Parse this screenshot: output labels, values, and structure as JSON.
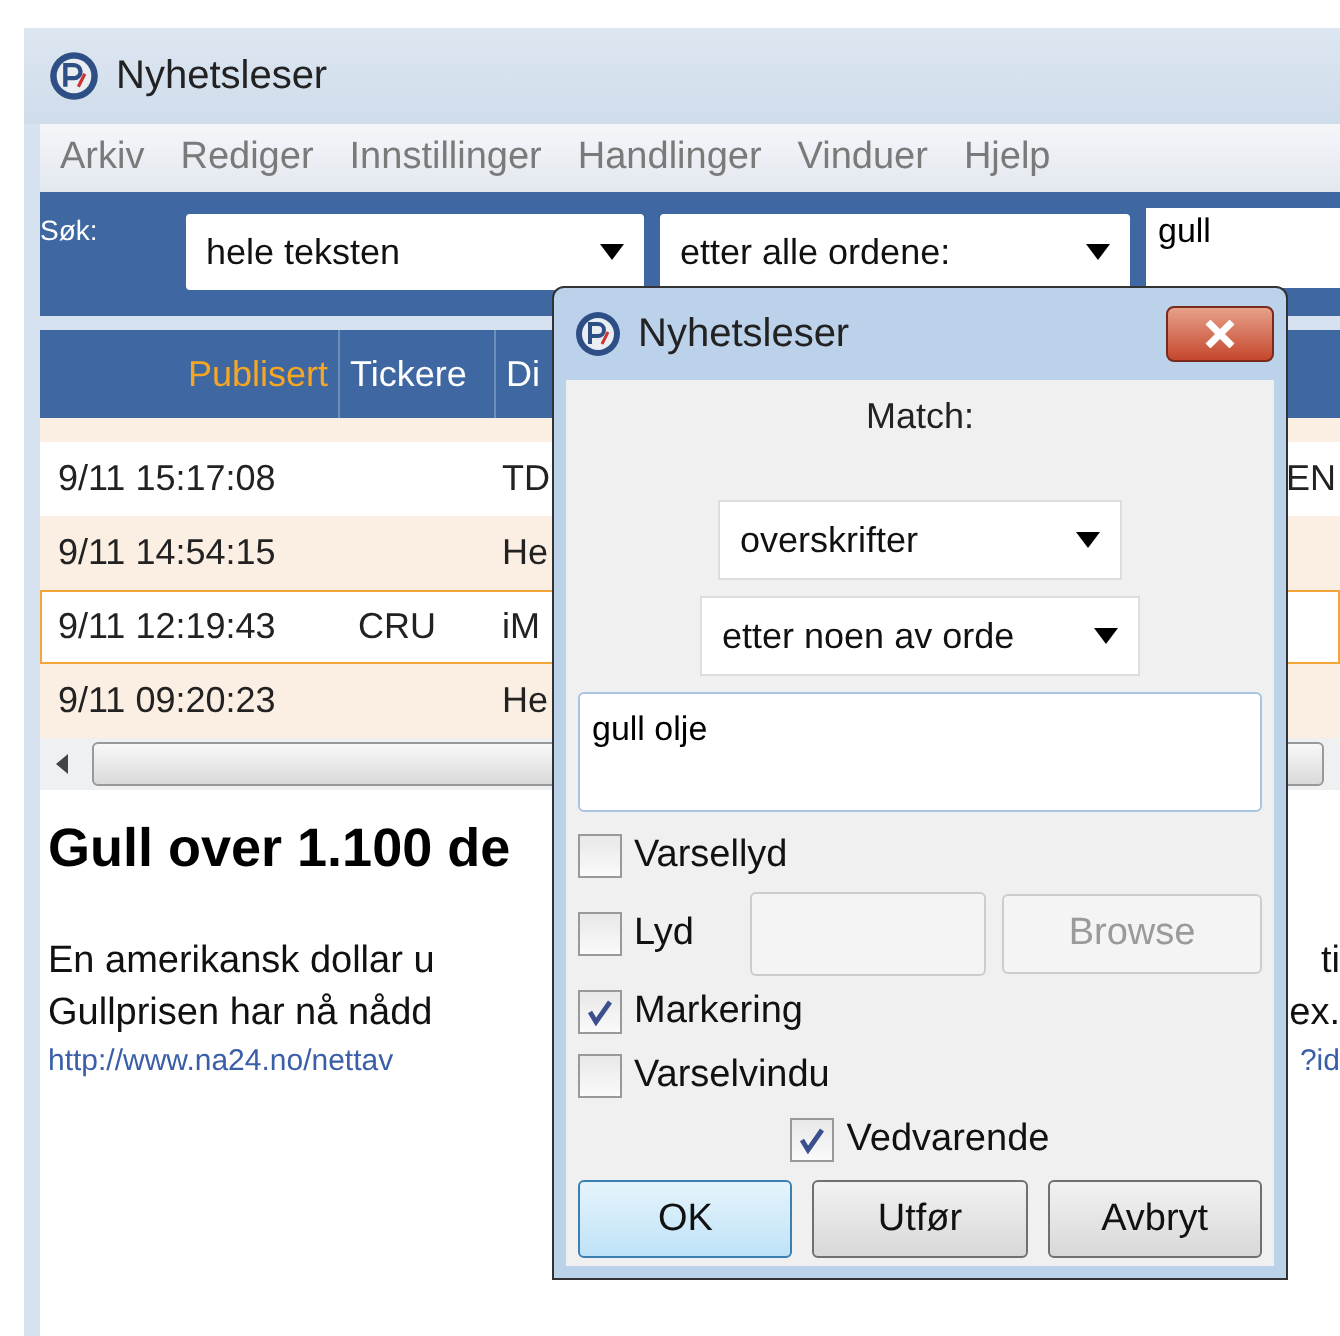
{
  "window": {
    "title": "Nyhetsleser"
  },
  "menu": [
    "Arkiv",
    "Rediger",
    "Innstillinger",
    "Handlinger",
    "Vinduer",
    "Hjelp"
  ],
  "search": {
    "label": "Søk:",
    "scope": "hele teksten",
    "mode": "etter alle ordene:",
    "value": "gull"
  },
  "table": {
    "columns": [
      "Publisert",
      "Tickere",
      "Di"
    ],
    "rows": [
      {
        "cells": [
          "9/11 15:17:08",
          "",
          "TD"
        ],
        "right": "EN",
        "selected": false
      },
      {
        "cells": [
          "9/11 14:54:15",
          "",
          "He"
        ],
        "right": "",
        "selected": false
      },
      {
        "cells": [
          "9/11 12:19:43",
          "CRU",
          "iM"
        ],
        "right": "",
        "selected": true
      },
      {
        "cells": [
          "9/11 09:20:23",
          "",
          "He"
        ],
        "right": "",
        "selected": false
      }
    ]
  },
  "article": {
    "headline": "Gull over 1.100 de",
    "lines": [
      {
        "left": "En amerikansk dollar u",
        "right": "ti",
        "kind": "text"
      },
      {
        "left": "Gullprisen har nå nådd",
        "right": "ex.",
        "kind": "text"
      },
      {
        "left": "http://www.na24.no/nettav",
        "right": "?id",
        "kind": "link"
      }
    ]
  },
  "dialog": {
    "title": "Nyhetsleser",
    "heading": "Match:",
    "field": "overskrifter",
    "mode": "etter noen av orde",
    "words": "gull olje",
    "options": [
      {
        "label": "Varsellyd",
        "checked": false,
        "kind": "check"
      },
      {
        "label": "Lyd",
        "checked": false,
        "kind": "file",
        "button": "Browse",
        "disabled": true
      },
      {
        "label": "Markering",
        "checked": true,
        "kind": "check"
      },
      {
        "label": "Varselvindu",
        "checked": false,
        "kind": "check"
      },
      {
        "label": "Vedvarende",
        "checked": true,
        "kind": "centered"
      }
    ],
    "buttons": [
      {
        "label": "OK",
        "default": true
      },
      {
        "label": "Utfør",
        "default": false
      },
      {
        "label": "Avbryt",
        "default": false
      }
    ]
  }
}
